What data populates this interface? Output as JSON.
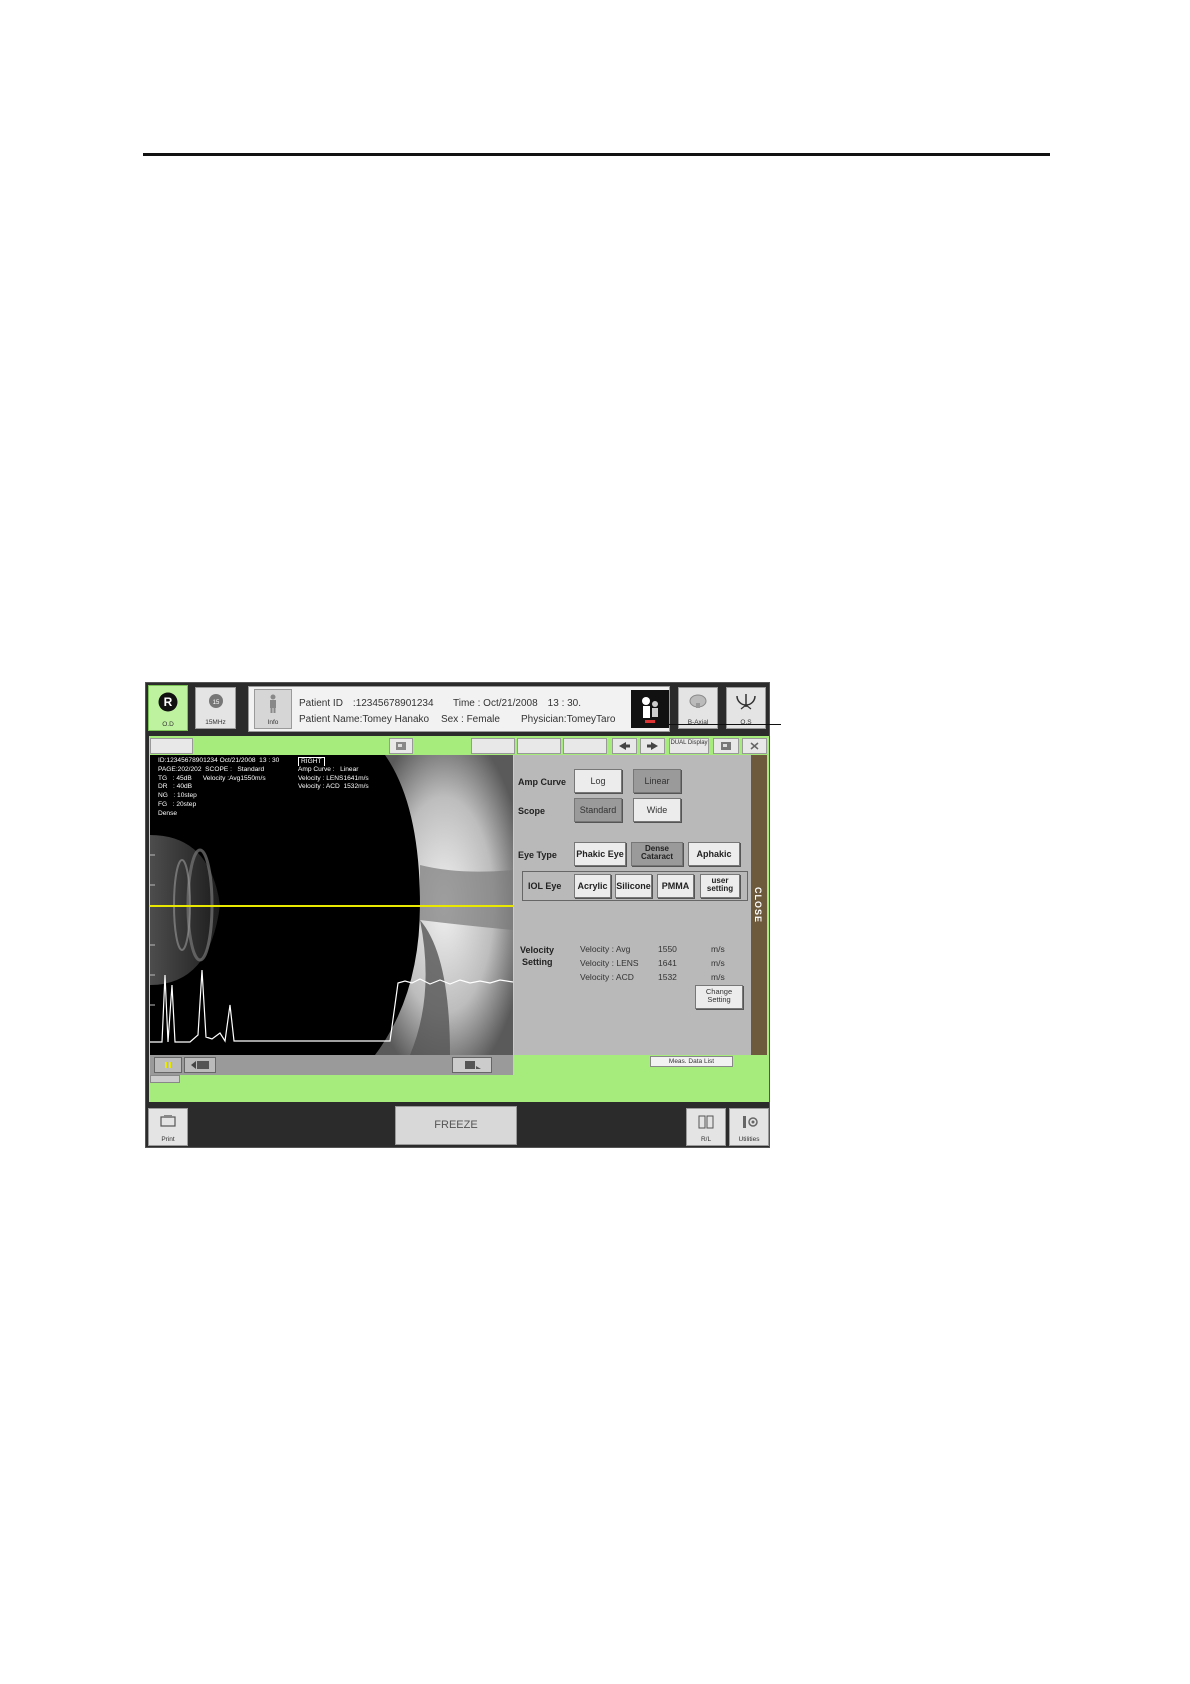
{
  "top_bar": {
    "od_label": "O.D",
    "probe_label": "15MHz",
    "probe_badge": "15",
    "info_label": "Info",
    "b_axial_label": "B-Axial",
    "os_label": "O.S"
  },
  "patient": {
    "patient_id": "Patient ID　:12345678901234",
    "time": "Time : Oct/21/2008　13 : 30.",
    "patient_name": "Patient Name:Tomey Hanako",
    "sex": "Sex : Female",
    "physician": "Physician:TomeyTaro"
  },
  "tabs": {
    "dual_display": "DUAL Display"
  },
  "overlay": {
    "line1": "ID:12345678901234 Oct/21/2008  13 : 30",
    "side": "RIGHT",
    "left_block": "PAGE:202/202  SCOPE :   Standard\nTG   : 45dB      Velocity :Avg1550m/s\nDR   : 40dB\nNG   : 10step\nFG   : 20step\nDense",
    "right_block": "Amp Curve :   Linear\nVelocity : LENS1641m/s\nVelocity : ACD  1532m/s"
  },
  "settings": {
    "amp_curve_label": "Amp Curve",
    "amp_log": "Log",
    "amp_linear": "Linear",
    "scope_label": "Scope",
    "scope_standard": "Standard",
    "scope_wide": "Wide",
    "eye_type_label": "Eye Type",
    "phakic_eye": "Phakic Eye",
    "dense_cataract": "Dense Cataract",
    "aphakic": "Aphakic",
    "iol_eye_label": "IOL Eye",
    "acrylic": "Acrylic",
    "silicone": "Silicone",
    "pmma": "PMMA",
    "user_setting": "user setting",
    "velocity_label_1": "Velocity",
    "velocity_label_2": "Setting",
    "velocity_rows": [
      {
        "name": "Velocity :  Avg",
        "value": "1550",
        "unit": "m/s"
      },
      {
        "name": "Velocity : LENS",
        "value": "1641",
        "unit": "m/s"
      },
      {
        "name": "Velocity :  ACD",
        "value": "1532",
        "unit": "m/s"
      }
    ],
    "change_setting": "Change Setting",
    "close_label": "CLOSE"
  },
  "meas_data_list": "Meas. Data List",
  "bottom_bar": {
    "print_label": "Print",
    "freeze_label": "FREEZE",
    "rl_label": "R/L",
    "utilities_label": "Utilities"
  },
  "colors": {
    "frame_green": "#a6ec7d",
    "close_tab": "#6d5a3d",
    "scan_line": "#e8e800"
  }
}
